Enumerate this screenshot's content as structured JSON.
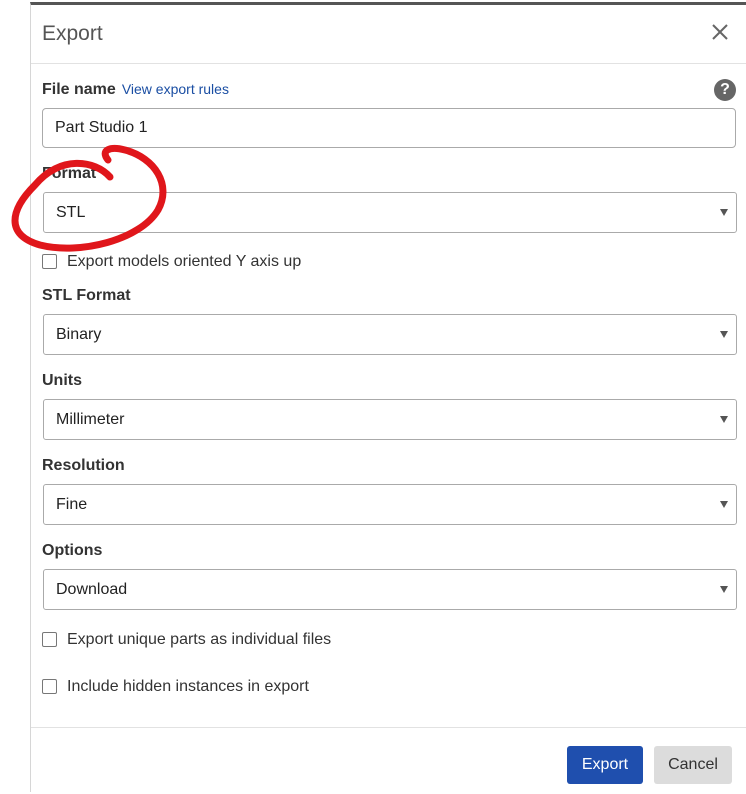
{
  "dialog": {
    "title": "Export",
    "close_icon": "close-icon"
  },
  "file_name": {
    "label": "File name",
    "link": "View export rules",
    "value": "Part Studio 1",
    "help_icon": "help-icon",
    "help_glyph": "?"
  },
  "format": {
    "label": "Format",
    "value": "STL"
  },
  "y_axis_checkbox": {
    "label": "Export models oriented Y axis up",
    "checked": false
  },
  "stl_format": {
    "label": "STL Format",
    "value": "Binary"
  },
  "units": {
    "label": "Units",
    "value": "Millimeter"
  },
  "resolution": {
    "label": "Resolution",
    "value": "Fine"
  },
  "options": {
    "label": "Options",
    "value": "Download"
  },
  "unique_parts_checkbox": {
    "label": "Export unique parts as individual files",
    "checked": false
  },
  "hidden_instances_checkbox": {
    "label": "Include hidden instances in export",
    "checked": false
  },
  "footer": {
    "export_label": "Export",
    "cancel_label": "Cancel"
  },
  "colors": {
    "primary": "#1f4fae",
    "annotation": "#e0161b"
  }
}
